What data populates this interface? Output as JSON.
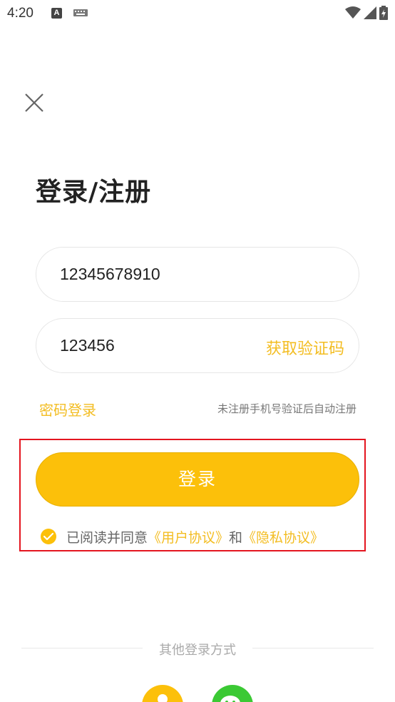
{
  "status_bar": {
    "time": "4:20",
    "a_icon_letter": "A"
  },
  "header": {
    "close_icon": "close-icon"
  },
  "page": {
    "title": "登录/注册"
  },
  "form": {
    "phone_value": "12345678910",
    "code_value": "123456",
    "get_code_label": "获取验证码",
    "password_login_label": "密码登录",
    "auto_register_hint": "未注册手机号验证后自动注册"
  },
  "login_button": {
    "label": "登录"
  },
  "agreement": {
    "checked": true,
    "prefix": "已阅读并同意",
    "user_agreement": "《用户协议》",
    "conjunction": "和",
    "privacy_policy": "《隐私协议》"
  },
  "other_login": {
    "label": "其他登录方式",
    "methods": [
      "phone-login-icon",
      "wechat-icon"
    ]
  },
  "colors": {
    "accent": "#fcc00a",
    "accent_text": "#f3bd22",
    "highlight": "#e4151f",
    "wechat": "#3bc934"
  }
}
